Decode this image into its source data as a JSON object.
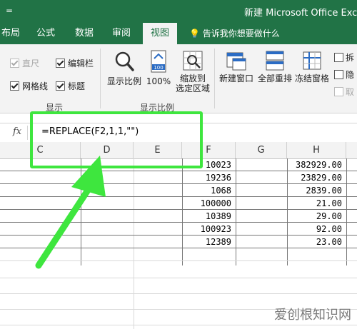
{
  "titlebar": {
    "title": "新建 Microsoft Office Excel",
    "quick_access": "="
  },
  "tabs": [
    {
      "label": "布局"
    },
    {
      "label": "公式"
    },
    {
      "label": "数据"
    },
    {
      "label": "审阅"
    },
    {
      "label": "视图",
      "active": true
    }
  ],
  "tell_me": "告诉我你想要做什么",
  "ribbon": {
    "show_group": {
      "ruler": "直尺",
      "formula_bar": "编辑栏",
      "gridlines": "网格线",
      "headings": "标题",
      "label": "显示"
    },
    "zoom_group": {
      "zoom": "显示比例",
      "zoom100": "100%",
      "zoom_selection_line1": "缩放到",
      "zoom_selection_line2": "选定区域",
      "label": "显示比例",
      "icon_100": "100"
    },
    "window_group": {
      "new_window": "新建窗口",
      "arrange_all": "全部重排",
      "freeze_panes": "冻结窗格",
      "split": "拆",
      "hide": "隐",
      "unhide": "取"
    }
  },
  "formula_bar": {
    "fx": "fx",
    "formula": "=REPLACE(F2,1,1,\"\")"
  },
  "columns": [
    "C",
    "D",
    "E",
    "F",
    "G",
    "H"
  ],
  "rows": [
    {
      "F": "10023",
      "H": "382929.00"
    },
    {
      "F": "19236",
      "H": "23829.00"
    },
    {
      "F": "1068",
      "H": "2839.00"
    },
    {
      "F": "100000",
      "H": "21.00"
    },
    {
      "F": "10389",
      "H": "29.00"
    },
    {
      "F": "100923",
      "H": "92.00"
    },
    {
      "F": "12389",
      "H": "23.00"
    }
  ],
  "watermark": "爱创根知识网",
  "accent_color": "#217346",
  "highlight_color": "#3ee63e"
}
